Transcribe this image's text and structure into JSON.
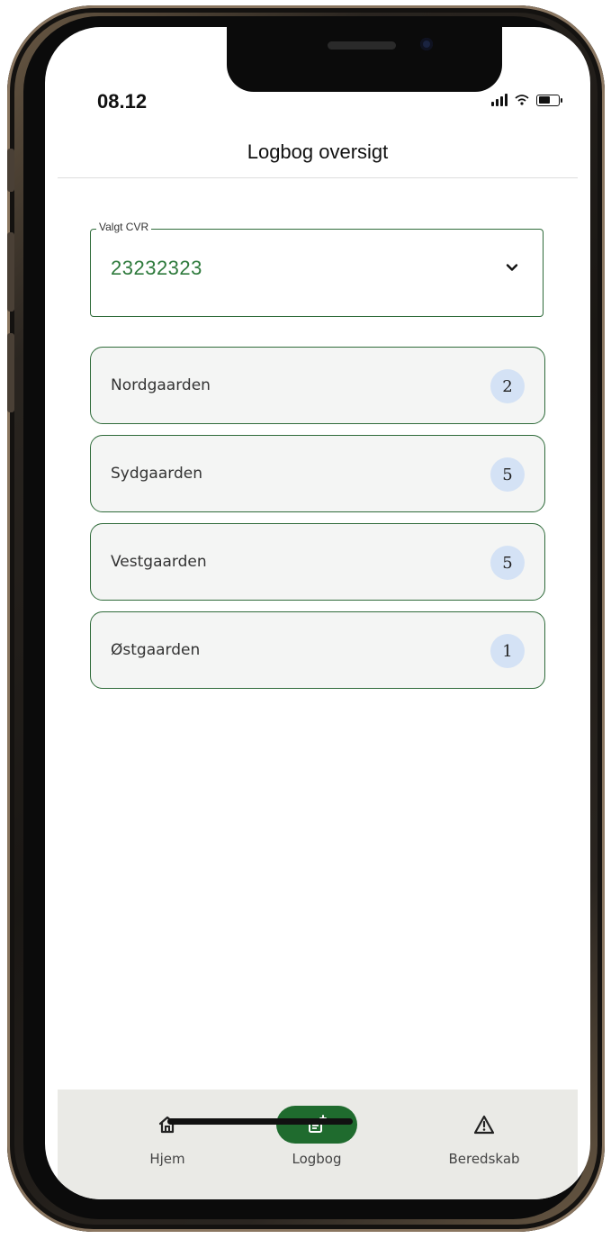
{
  "status_bar": {
    "time": "08.12",
    "icons": [
      "signal-icon",
      "wifi-icon",
      "battery-icon"
    ]
  },
  "header": {
    "title": "Logbog oversigt"
  },
  "cvr_select": {
    "label": "Valgt CVR",
    "value": "23232323",
    "icon": "chevron-down-icon"
  },
  "farms": [
    {
      "name": "Nordgaarden",
      "count": "2"
    },
    {
      "name": "Sydgaarden",
      "count": "5"
    },
    {
      "name": "Vestgaarden",
      "count": "5"
    },
    {
      "name": "Østgaarden",
      "count": "1"
    }
  ],
  "bottom_nav": {
    "items": [
      {
        "label": "Hjem",
        "icon": "home-icon",
        "active": false
      },
      {
        "label": "Logbog",
        "icon": "logbook-add-icon",
        "active": true
      },
      {
        "label": "Beredskab",
        "icon": "warning-triangle-icon",
        "active": false
      }
    ]
  },
  "colors": {
    "accent": "#1f6b2e",
    "cvr_value": "#2e7a3c",
    "badge_bg": "#d4e2f5",
    "nav_bg": "#eaeae6",
    "card_bg": "#f4f5f4"
  }
}
